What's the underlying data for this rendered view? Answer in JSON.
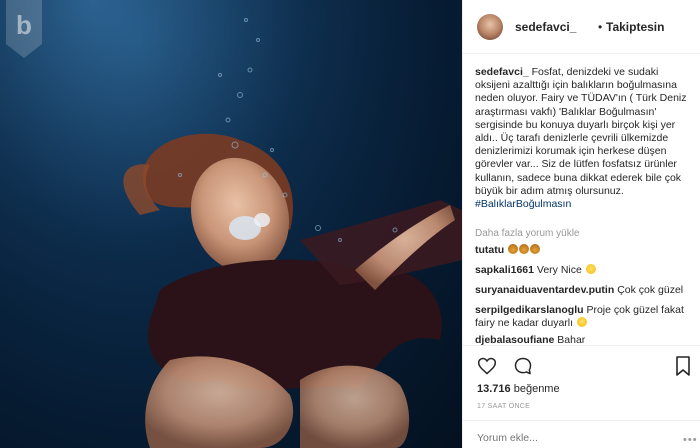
{
  "header": {
    "username": "sedefavci_",
    "dot": "•",
    "follow_status": "Takiptesin"
  },
  "caption": {
    "username": "sedefavci_",
    "text": "Fosfat, denizdeki ve sudaki oksijeni azalttığı için balıkların boğulmasına neden oluyor. Fairy ve TÜDAV'ın ( Türk Deniz araştırması vakfı) 'Balıklar Boğulmasın' sergisinde bu konuya duyarlı birçok kişi yer aldı.. Üç tarafı denizlerle çevrili ülkemizde denizlerimizi korumak için herkese düşen görevler var... Siz de lütfen fosfatsız ürünler kullanın, sadece buna dikkat ederek bile çok büyük bir adım atmış olursunuz.",
    "hashtag": "#BalıklarBoğulmasın"
  },
  "load_more": "Daha fazla yorum yükle",
  "comments": [
    {
      "username": "tutatu",
      "text": ""
    },
    {
      "username": "sapkali1661",
      "text": "Very Nice"
    },
    {
      "username": "suryanaiduaventardev.putin",
      "text": "Çok çok güzel"
    },
    {
      "username": "serpilgedikarslanoglu",
      "text": "Proje çok güzel fakat fairy ne kadar duyarlı"
    },
    {
      "username": "djebalasoufiane",
      "text": "Bahar"
    }
  ],
  "likes": {
    "count": "13.716",
    "label": "beğenme"
  },
  "timestamp": "17 SAAT ÖNCE",
  "add_comment_placeholder": "Yorum ekle...",
  "icons": [
    "heart-icon",
    "comment-icon",
    "bookmark-icon",
    "more-options-icon"
  ],
  "colors": {
    "hashtag": "#003569",
    "muted": "#999999",
    "water": "#0c2b4a"
  }
}
